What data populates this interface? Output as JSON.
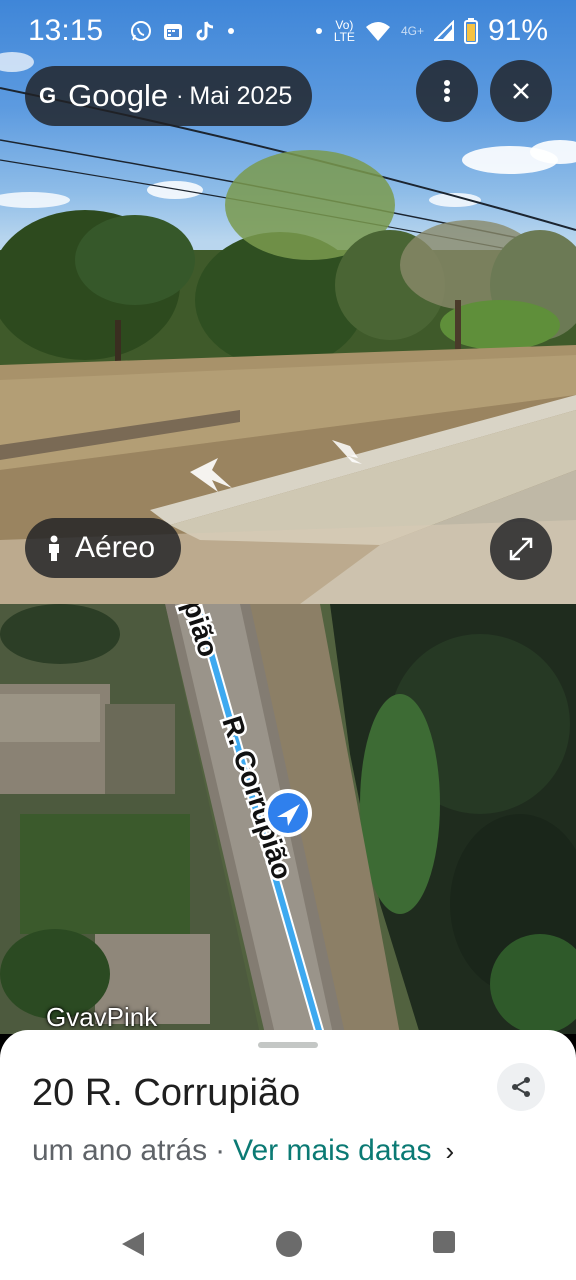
{
  "status_bar": {
    "time": "13:15",
    "battery": "91%",
    "network_small_top": "Vo)",
    "network_small_bottom": "LTE",
    "network_4g": "4G+"
  },
  "street_view": {
    "brand_letter": "G",
    "brand": "Google",
    "separator": "·",
    "capture_date": "Mai 2025",
    "aerial_button_label": "Aéreo",
    "icons": [
      "google-g-icon",
      "more-vert-icon",
      "close-icon",
      "person-icon",
      "expand-icon"
    ]
  },
  "map": {
    "street_label_top": "pião",
    "street_label_main": "R. Corrupião",
    "business_label": "GvavPink"
  },
  "sheet": {
    "address": "20 R. Corrupião",
    "age": "um ano atrás",
    "separator": "·",
    "more_dates_link": "Ver mais datas",
    "chevron": "›"
  },
  "colors": {
    "accent_link": "#0b7a74",
    "route_blue": "#3da9f0",
    "chip_bg": "#202124"
  }
}
